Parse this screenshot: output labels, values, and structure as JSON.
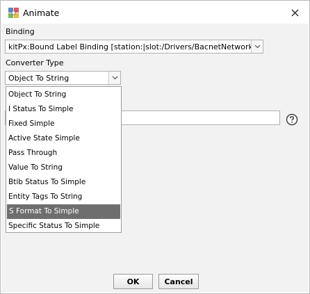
{
  "window": {
    "title": "Animate",
    "icon": "animate-app-icon",
    "close_icon": "close-icon"
  },
  "binding": {
    "label": "Binding",
    "value": "kitPx:Bound Label Binding [station:|slot:/Drivers/BacnetNetwork]"
  },
  "converter": {
    "label": "Converter Type",
    "selected": "Object To String",
    "options": [
      "Object To String",
      "I Status To Simple",
      "Fixed Simple",
      "Active State Simple",
      "Pass Through",
      "Value To String",
      "Btib Status To Simple",
      "Entity Tags To String",
      "S Format To Simple",
      "Specific Status To Simple"
    ],
    "highlighted_option": "S Format To Simple"
  },
  "buttons": {
    "ok": "OK",
    "cancel": "Cancel"
  },
  "colors": {
    "highlight": "#6e6e6e",
    "panel_bg": "#f2f2f2"
  }
}
